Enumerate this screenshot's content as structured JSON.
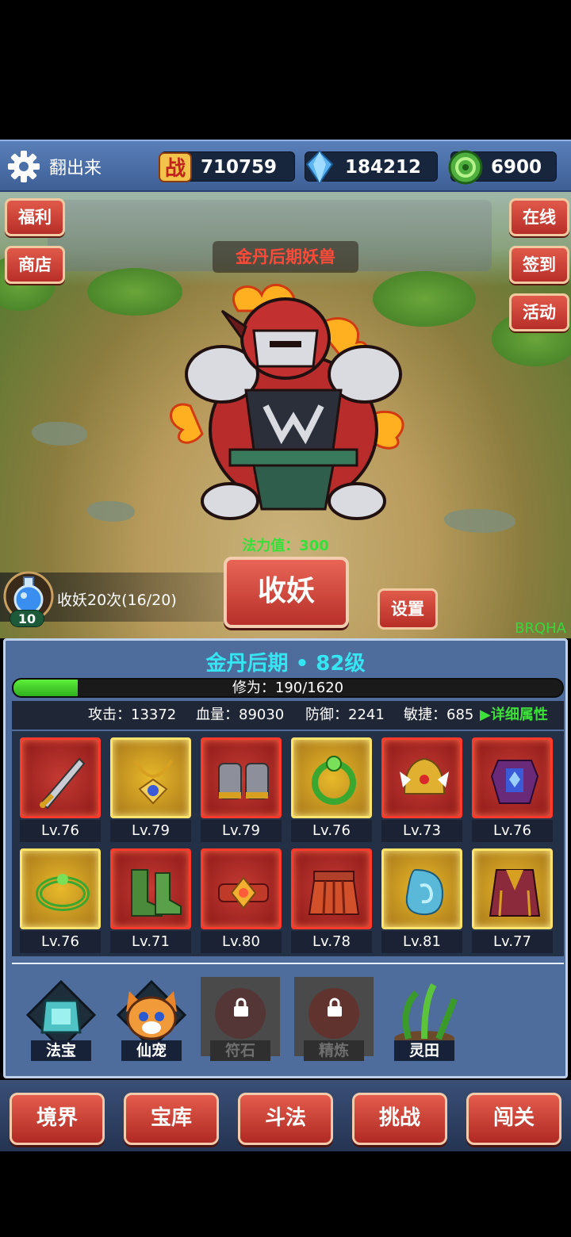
{
  "topbar": {
    "player_name": "翻出来",
    "combat_icon_text": "战",
    "combat_power": "710759",
    "diamonds": "184212",
    "jade": "6900"
  },
  "scene": {
    "left_buttons": [
      "福利",
      "商店"
    ],
    "right_buttons": [
      "在线",
      "签到",
      "活动"
    ],
    "enemy_name": "金丹后期妖兽",
    "mana_text": "法力值：300",
    "capture_button": "收妖",
    "settings_button": "设置",
    "capture_count": "收妖20次(16/20)",
    "potion_count": "10",
    "brand": "BRQHA"
  },
  "panel": {
    "realm": "金丹后期 • 82级",
    "exp_text": "修为：190/1620",
    "exp_progress": 0.117,
    "stats": {
      "attack": "攻击：13372",
      "hp": "血量：89030",
      "defense": "防御：2241",
      "agility": "敏捷：685",
      "detail_link": "▶详细属性"
    },
    "equipment": [
      {
        "name": "sword",
        "level": "Lv.76",
        "rarity": "red"
      },
      {
        "name": "necklace",
        "level": "Lv.79",
        "rarity": "gold"
      },
      {
        "name": "gauntlets",
        "level": "Lv.79",
        "rarity": "red"
      },
      {
        "name": "ring",
        "level": "Lv.76",
        "rarity": "gold"
      },
      {
        "name": "helmet",
        "level": "Lv.73",
        "rarity": "red"
      },
      {
        "name": "armor",
        "level": "Lv.76",
        "rarity": "red"
      },
      {
        "name": "bracelet",
        "level": "Lv.76",
        "rarity": "gold"
      },
      {
        "name": "boots",
        "level": "Lv.71",
        "rarity": "red"
      },
      {
        "name": "belt",
        "level": "Lv.80",
        "rarity": "red"
      },
      {
        "name": "skirt",
        "level": "Lv.78",
        "rarity": "red"
      },
      {
        "name": "jade-pendant",
        "level": "Lv.81",
        "rarity": "gold"
      },
      {
        "name": "cloak",
        "level": "Lv.77",
        "rarity": "gold"
      }
    ],
    "functions": [
      {
        "label": "法宝",
        "locked": false
      },
      {
        "label": "仙宠",
        "locked": false
      },
      {
        "label": "符石",
        "locked": true
      },
      {
        "label": "精炼",
        "locked": true
      },
      {
        "label": "灵田",
        "locked": false
      }
    ]
  },
  "nav": [
    "境界",
    "宝库",
    "斗法",
    "挑战",
    "闯关"
  ]
}
